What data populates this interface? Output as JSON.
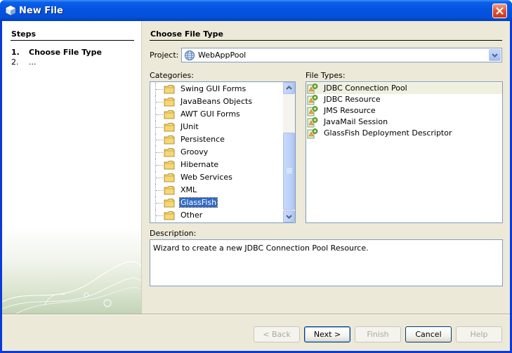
{
  "window": {
    "title": "New File",
    "title_icon": "netbeans-cube-icon",
    "close_icon": "close-icon"
  },
  "steps": {
    "heading": "Steps",
    "items": [
      {
        "num": "1.",
        "label": "Choose File Type"
      },
      {
        "num": "2.",
        "label": "..."
      }
    ]
  },
  "main": {
    "heading": "Choose File Type",
    "project_label": "Project:",
    "project_value": "WebAppPool",
    "categories_label": "Categories:",
    "file_types_label": "File Types:",
    "description_label": "Description:",
    "description": "Wizard to create a new JDBC Connection Pool Resource."
  },
  "categories": [
    {
      "label": "Swing GUI Forms"
    },
    {
      "label": "JavaBeans Objects"
    },
    {
      "label": "AWT GUI Forms"
    },
    {
      "label": "JUnit"
    },
    {
      "label": "Persistence"
    },
    {
      "label": "Groovy"
    },
    {
      "label": "Hibernate"
    },
    {
      "label": "Web Services"
    },
    {
      "label": "XML"
    },
    {
      "label": "GlassFish"
    },
    {
      "label": "Other"
    }
  ],
  "selected_category": "GlassFish",
  "file_types": [
    {
      "label": "JDBC Connection Pool"
    },
    {
      "label": "JDBC Resource"
    },
    {
      "label": "JMS Resource"
    },
    {
      "label": "JavaMail Session"
    },
    {
      "label": "GlassFish Deployment Descriptor"
    }
  ],
  "selected_file_type": "JDBC Connection Pool",
  "buttons": {
    "back": "< Back",
    "next": "Next >",
    "finish": "Finish",
    "cancel": "Cancel",
    "help": "Help"
  },
  "colors": {
    "titlebar": "#0554e0",
    "selection": "#316ac5",
    "dialog_bg": "#ece9d8"
  }
}
